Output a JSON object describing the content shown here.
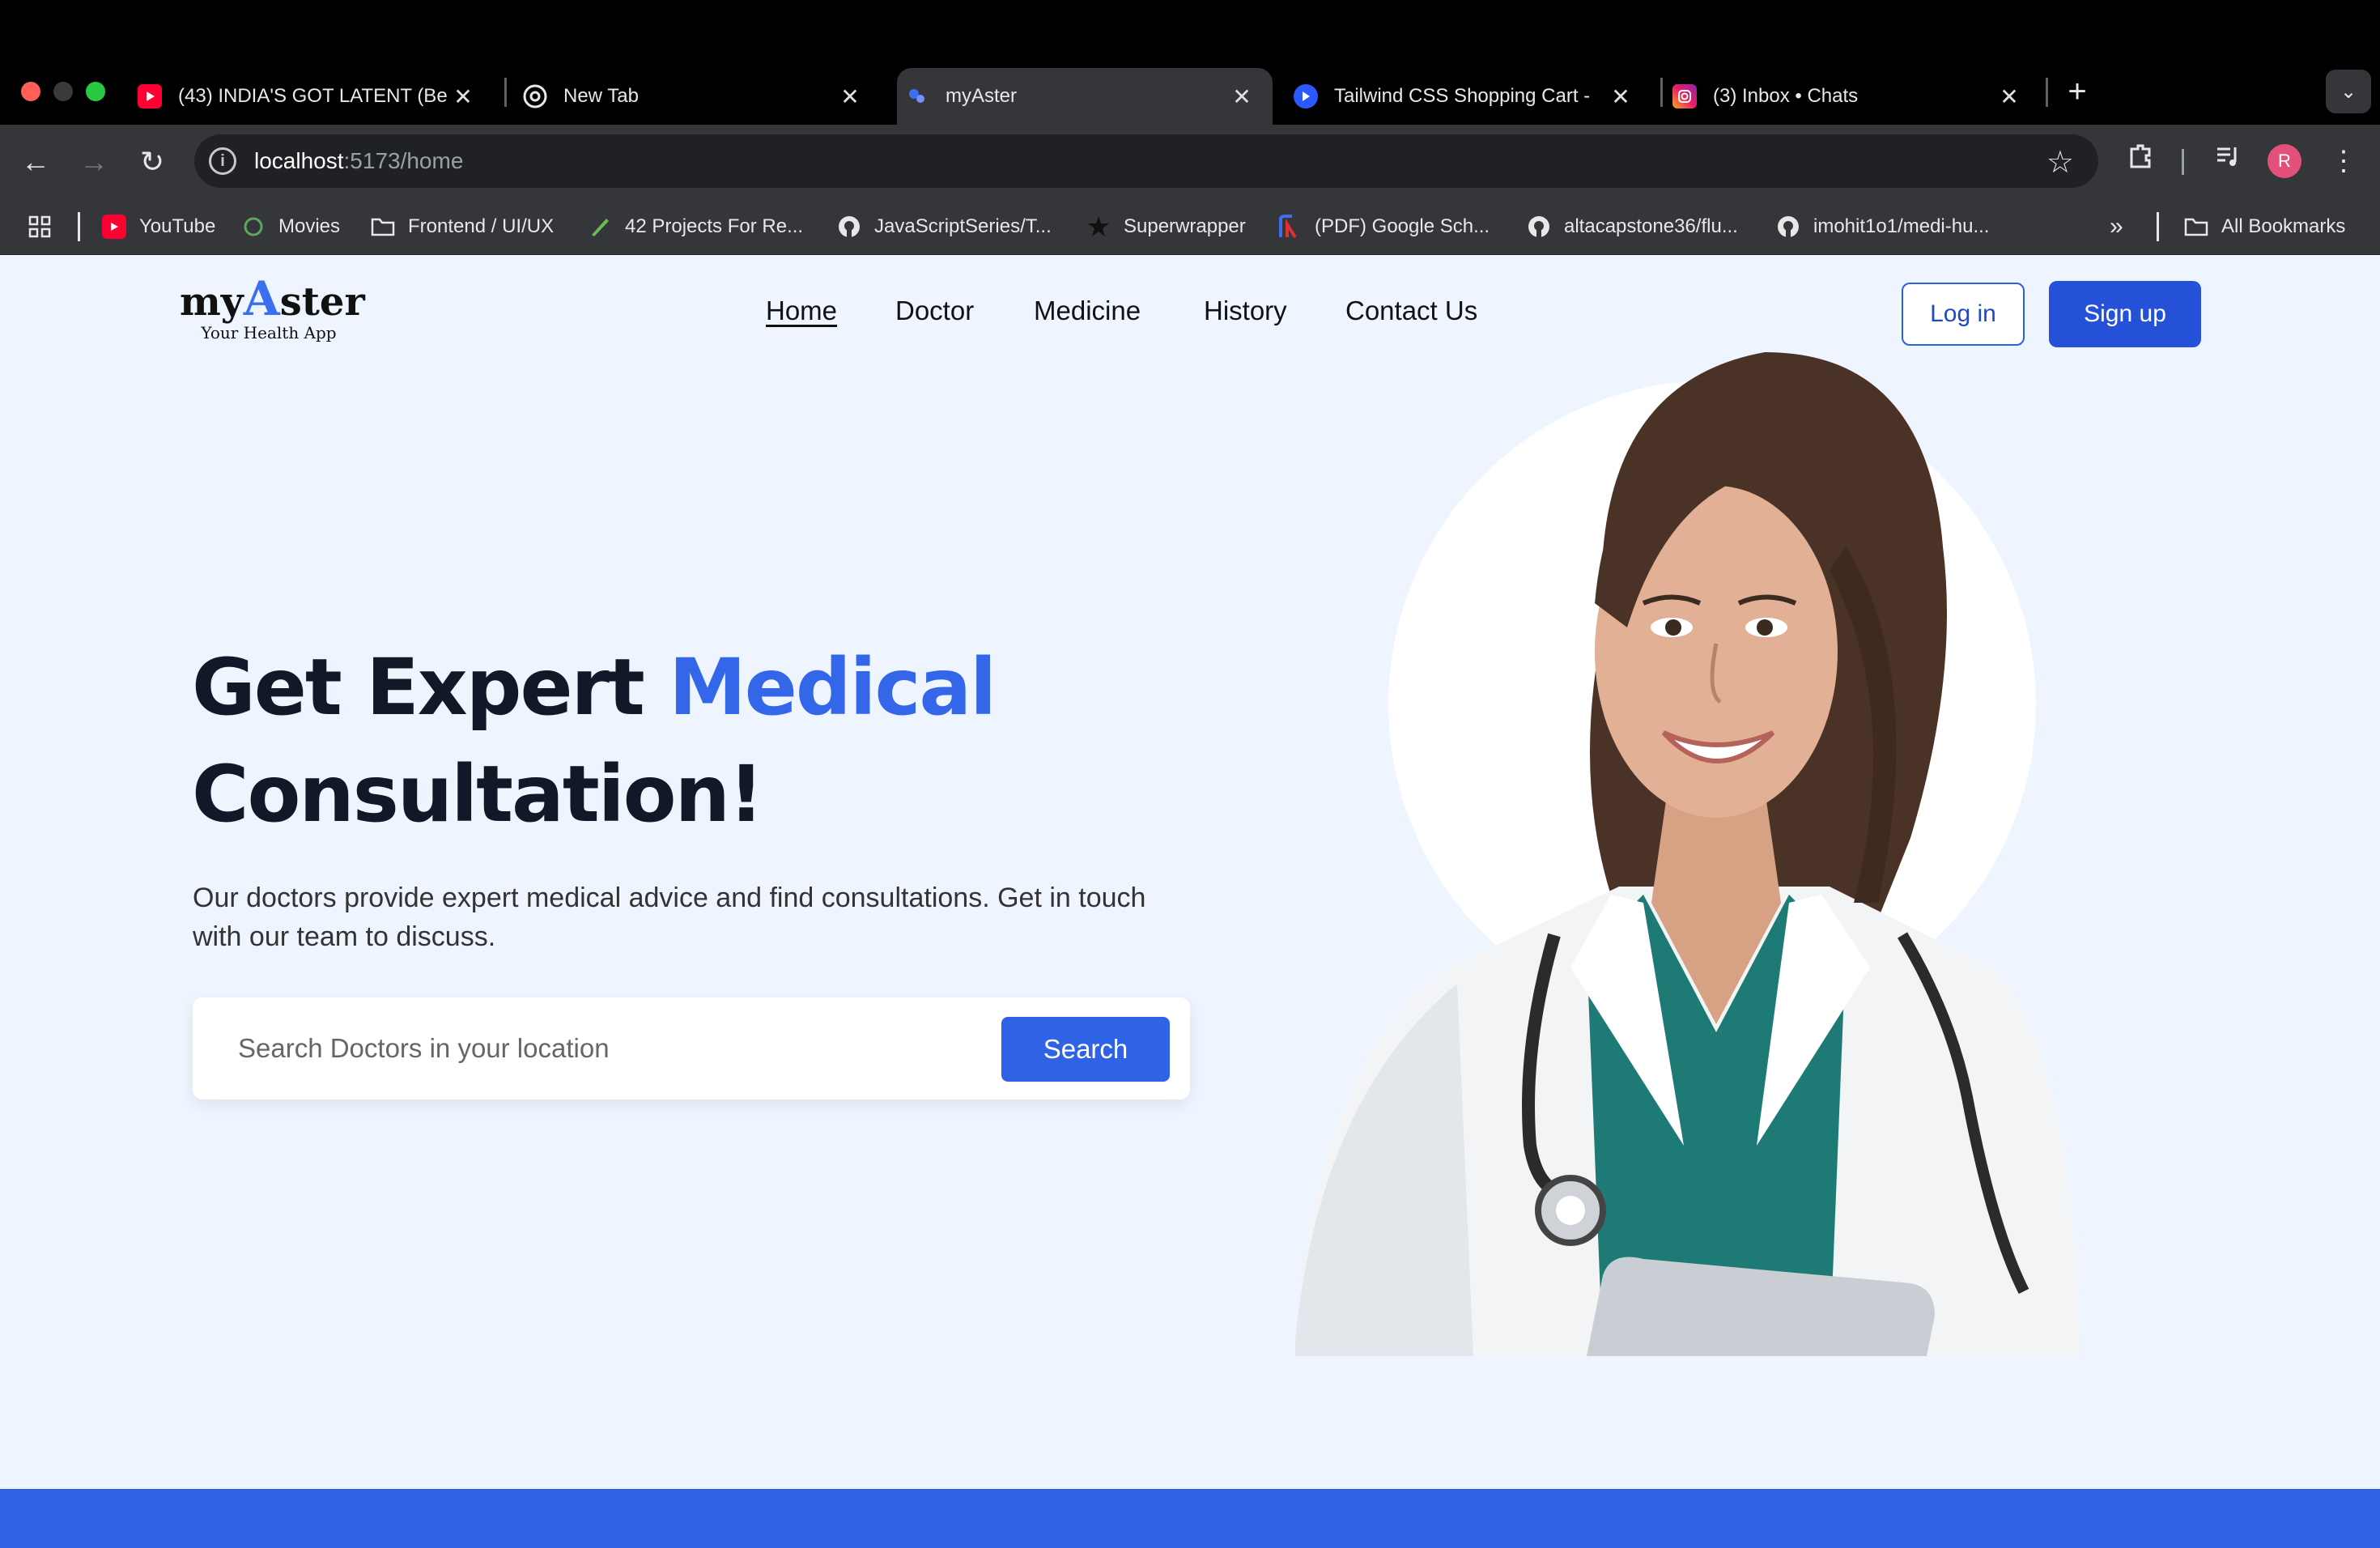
{
  "browser": {
    "tabs": [
      {
        "title": "(43) INDIA'S GOT LATENT (Be",
        "icon": "youtube-icon"
      },
      {
        "title": "New Tab",
        "icon": "chrome-icon"
      },
      {
        "title": "myAster",
        "icon": "myaster-favicon",
        "active": true
      },
      {
        "title": "Tailwind CSS Shopping Cart -",
        "icon": "tailwind-favicon"
      },
      {
        "title": "(3) Inbox • Chats",
        "icon": "instagram-icon"
      }
    ],
    "address": {
      "host": "localhost",
      "rest": ":5173/home"
    },
    "profile_initial": "R",
    "bookmarks": [
      {
        "label": "YouTube",
        "icon": "youtube-icon"
      },
      {
        "label": "Movies",
        "icon": "movies-icon"
      },
      {
        "label": "Frontend / UI/UX",
        "icon": "folder-icon"
      },
      {
        "label": "42 Projects For Re...",
        "icon": "pen-icon"
      },
      {
        "label": "JavaScriptSeries/T...",
        "icon": "github-icon"
      },
      {
        "label": "Superwrapper",
        "icon": "star-burst-icon"
      },
      {
        "label": "(PDF) Google Sch...",
        "icon": "researchgate-icon"
      },
      {
        "label": "altacapstone36/flu...",
        "icon": "github-icon"
      },
      {
        "label": "imohit1o1/medi-hu...",
        "icon": "github-icon"
      }
    ],
    "all_bookmarks": "All Bookmarks",
    "overflow": "»"
  },
  "site": {
    "logo_prefix": "my",
    "logo_accent": "A",
    "logo_suffix": "ster",
    "logo_tagline": "Your Health App",
    "nav": [
      "Home",
      "Doctor",
      "Medicine",
      "History",
      "Contact Us"
    ],
    "login": "Log in",
    "signup": "Sign up"
  },
  "hero": {
    "title_part1": "Get Expert ",
    "title_highlight": "Medical",
    "title_part2": "Consultation!",
    "description": "Our doctors provide expert medical advice and find consultations. Get in touch with our team to discuss.",
    "search_placeholder": "Search Doctors in your location",
    "search_button": "Search"
  },
  "colors": {
    "accent": "#3366e8",
    "button": "#2550d8",
    "page_bg": "#eef5ff"
  }
}
